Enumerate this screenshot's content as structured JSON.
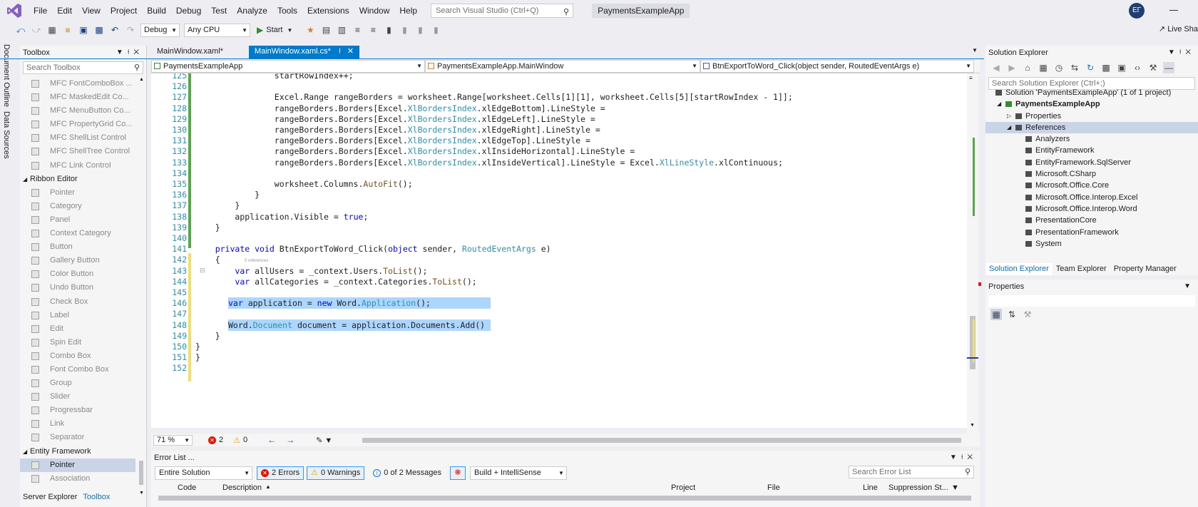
{
  "menu": {
    "items": [
      "File",
      "Edit",
      "View",
      "Project",
      "Build",
      "Debug",
      "Test",
      "Analyze",
      "Tools",
      "Extensions",
      "Window",
      "Help"
    ],
    "search_placeholder": "Search Visual Studio (Ctrl+Q)",
    "solution_name": "PaymentsExampleApp",
    "avatar_initials": "EГ"
  },
  "toolbar": {
    "config": "Debug",
    "platform": "Any CPU",
    "start_label": "Start",
    "live_share": "Live Sha"
  },
  "left_rail": {
    "tabs": [
      "Document Outline",
      "Data Sources"
    ]
  },
  "toolbox": {
    "title": "Toolbox",
    "search_placeholder": "Search Toolbox",
    "rows": [
      {
        "label": "MFC FontComboBox ...",
        "kind": "item"
      },
      {
        "label": "MFC MaskedEdit Co...",
        "kind": "item"
      },
      {
        "label": "MFC MenuButton Co...",
        "kind": "item"
      },
      {
        "label": "MFC PropertyGrid Co...",
        "kind": "item"
      },
      {
        "label": "MFC ShellList Control",
        "kind": "item"
      },
      {
        "label": "MFC ShellTree Control",
        "kind": "item"
      },
      {
        "label": "MFC Link Control",
        "kind": "item"
      },
      {
        "label": "Ribbon Editor",
        "kind": "category"
      },
      {
        "label": "Pointer",
        "kind": "item"
      },
      {
        "label": "Category",
        "kind": "item"
      },
      {
        "label": "Panel",
        "kind": "item"
      },
      {
        "label": "Context Category",
        "kind": "item"
      },
      {
        "label": "Button",
        "kind": "item"
      },
      {
        "label": "Gallery Button",
        "kind": "item"
      },
      {
        "label": "Color Button",
        "kind": "item"
      },
      {
        "label": "Undo Button",
        "kind": "item"
      },
      {
        "label": "Check Box",
        "kind": "item"
      },
      {
        "label": "Label",
        "kind": "item"
      },
      {
        "label": "Edit",
        "kind": "item"
      },
      {
        "label": "Spin Edit",
        "kind": "item"
      },
      {
        "label": "Combo Box",
        "kind": "item"
      },
      {
        "label": "Font Combo Box",
        "kind": "item"
      },
      {
        "label": "Group",
        "kind": "item"
      },
      {
        "label": "Slider",
        "kind": "item"
      },
      {
        "label": "Progressbar",
        "kind": "item"
      },
      {
        "label": "Link",
        "kind": "item"
      },
      {
        "label": "Separator",
        "kind": "item"
      },
      {
        "label": "Entity Framework",
        "kind": "category"
      },
      {
        "label": "Pointer",
        "kind": "selected"
      },
      {
        "label": "Association",
        "kind": "item"
      }
    ],
    "bottom_tabs": [
      "Server Explorer",
      "Toolbox"
    ]
  },
  "editor": {
    "tabs": [
      {
        "label": "MainWindow.xaml*",
        "active": false
      },
      {
        "label": "MainWindow.xaml.cs*",
        "active": true
      }
    ],
    "nav": {
      "project": "PaymentsExampleApp",
      "class": "PaymentsExampleApp.MainWindow",
      "member": "BtnExportToWord_Click(object sender, RoutedEventArgs e)"
    },
    "codelens": "0 references",
    "lines": [
      {
        "n": "125",
        "code": "                startRowIndex++;"
      },
      {
        "n": "126",
        "code": ""
      },
      {
        "n": "127",
        "code": "                Excel.Range rangeBorders = worksheet.Range[worksheet.Cells[1][1], worksheet.Cells[5][startRowIndex - 1]];"
      },
      {
        "n": "128",
        "code": "                rangeBorders.Borders[Excel.XlBordersIndex.xlEdgeBottom].LineStyle ="
      },
      {
        "n": "129",
        "code": "                rangeBorders.Borders[Excel.XlBordersIndex.xlEdgeLeft].LineStyle ="
      },
      {
        "n": "130",
        "code": "                rangeBorders.Borders[Excel.XlBordersIndex.xlEdgeRight].LineStyle ="
      },
      {
        "n": "131",
        "code": "                rangeBorders.Borders[Excel.XlBordersIndex.xlEdgeTop].LineStyle ="
      },
      {
        "n": "132",
        "code": "                rangeBorders.Borders[Excel.XlBordersIndex.xlInsideHorizontal].LineStyle ="
      },
      {
        "n": "133",
        "code": "                rangeBorders.Borders[Excel.XlBordersIndex.xlInsideVertical].LineStyle = Excel.XlLineStyle.xlContinuous;"
      },
      {
        "n": "134",
        "code": ""
      },
      {
        "n": "135",
        "code": "                worksheet.Columns.AutoFit();"
      },
      {
        "n": "136",
        "code": "            }"
      },
      {
        "n": "137",
        "code": "        }"
      },
      {
        "n": "138",
        "code": "        application.Visible = true;"
      },
      {
        "n": "139",
        "code": "    }"
      },
      {
        "n": "140",
        "code": ""
      },
      {
        "n": "141",
        "code": "    private void BtnExportToWord_Click(object sender, RoutedEventArgs e)"
      },
      {
        "n": "142",
        "code": "    {"
      },
      {
        "n": "143",
        "code": "        var allUsers = _context.Users.ToList();"
      },
      {
        "n": "144",
        "code": "        var allCategories = _context.Categories.ToList();"
      },
      {
        "n": "145",
        "code": ""
      },
      {
        "n": "146",
        "code": "        var application = new Word.Application();"
      },
      {
        "n": "147",
        "code": ""
      },
      {
        "n": "148",
        "code": "        Word.Document document = application.Documents.Add()"
      },
      {
        "n": "149",
        "code": "    }"
      },
      {
        "n": "150",
        "code": "}"
      },
      {
        "n": "151",
        "code": "}"
      },
      {
        "n": "152",
        "code": ""
      }
    ],
    "zoom": "71 %",
    "errors": "2",
    "warnings": "0"
  },
  "error_list": {
    "title": "Error List ...",
    "scope": "Entire Solution",
    "errors_btn": "2 Errors",
    "warnings_btn": "0 Warnings",
    "messages_btn": "0 of 2 Messages",
    "build_filter": "Build + IntelliSense",
    "search_placeholder": "Search Error List",
    "columns": [
      "Code",
      "Description",
      "Project",
      "File",
      "Line",
      "Suppression St..."
    ]
  },
  "solution_explorer": {
    "title": "Solution Explorer",
    "search_placeholder": "Search Solution Explorer (Ctrl+;)",
    "tree": [
      {
        "label": "Solution 'PaymentsExampleApp' (1 of 1 project)",
        "level": 0,
        "bold": false
      },
      {
        "label": "PaymentsExampleApp",
        "level": 1,
        "bold": true
      },
      {
        "label": "Properties",
        "level": 2,
        "bold": false
      },
      {
        "label": "References",
        "level": 2,
        "bold": false
      },
      {
        "label": "Analyzers",
        "level": 3,
        "bold": false
      },
      {
        "label": "EntityFramework",
        "level": 3,
        "bold": false
      },
      {
        "label": "EntityFramework.SqlServer",
        "level": 3,
        "bold": false
      },
      {
        "label": "Microsoft.CSharp",
        "level": 3,
        "bold": false
      },
      {
        "label": "Microsoft.Office.Core",
        "level": 3,
        "bold": false
      },
      {
        "label": "Microsoft.Office.Interop.Excel",
        "level": 3,
        "bold": false
      },
      {
        "label": "Microsoft.Office.Interop.Word",
        "level": 3,
        "bold": false
      },
      {
        "label": "PresentationCore",
        "level": 3,
        "bold": false
      },
      {
        "label": "PresentationFramework",
        "level": 3,
        "bold": false
      },
      {
        "label": "System",
        "level": 3,
        "bold": false
      }
    ],
    "tabs": [
      "Solution Explorer",
      "Team Explorer",
      "Property Manager"
    ]
  },
  "properties": {
    "title": "Properties"
  },
  "colors": {
    "accent": "#007acc",
    "keyword": "#0000ff",
    "type": "#2b91af",
    "selection": "#add6ff"
  }
}
